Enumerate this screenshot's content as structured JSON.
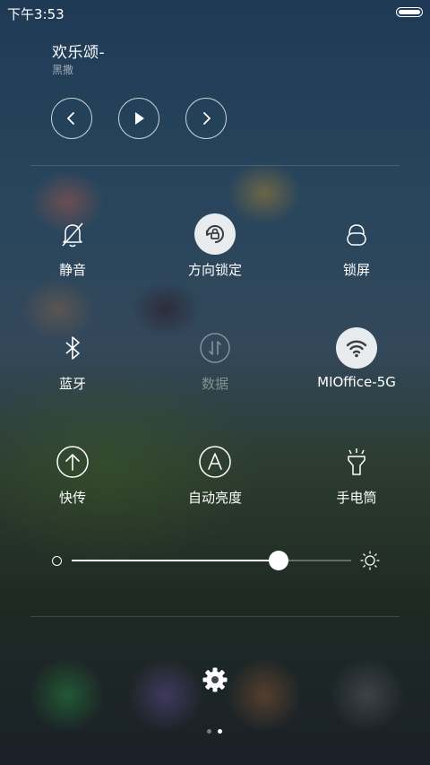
{
  "status_bar": {
    "time": "下午3:53"
  },
  "media": {
    "title": "欢乐颂-",
    "artist": "黑撒",
    "buttons": [
      "previous",
      "play",
      "next"
    ]
  },
  "toggles": [
    {
      "id": "mute",
      "label": "静音",
      "icon": "bell-off-icon",
      "state": "off"
    },
    {
      "id": "rotation-lock",
      "label": "方向锁定",
      "icon": "rotation-lock-icon",
      "state": "on"
    },
    {
      "id": "lock-screen",
      "label": "锁屏",
      "icon": "lock-icon",
      "state": "off"
    },
    {
      "id": "bluetooth",
      "label": "蓝牙",
      "icon": "bluetooth-icon",
      "state": "off"
    },
    {
      "id": "data",
      "label": "数据",
      "icon": "data-icon",
      "state": "disabled"
    },
    {
      "id": "wifi",
      "label": "MIOffice-5G",
      "icon": "wifi-icon",
      "state": "on"
    },
    {
      "id": "quick-transfer",
      "label": "快传",
      "icon": "upload-icon",
      "state": "off"
    },
    {
      "id": "auto-brightness",
      "label": "自动亮度",
      "icon": "auto-brightness-icon",
      "state": "off"
    },
    {
      "id": "flashlight",
      "label": "手电筒",
      "icon": "flashlight-icon",
      "state": "off"
    }
  ],
  "brightness": {
    "level": 0.74
  },
  "pager": {
    "count": 2,
    "active": 1
  },
  "colors": {
    "active_tile_bg": "#e9ecef",
    "active_icon": "#3a3d42",
    "text": "#ffffff"
  }
}
